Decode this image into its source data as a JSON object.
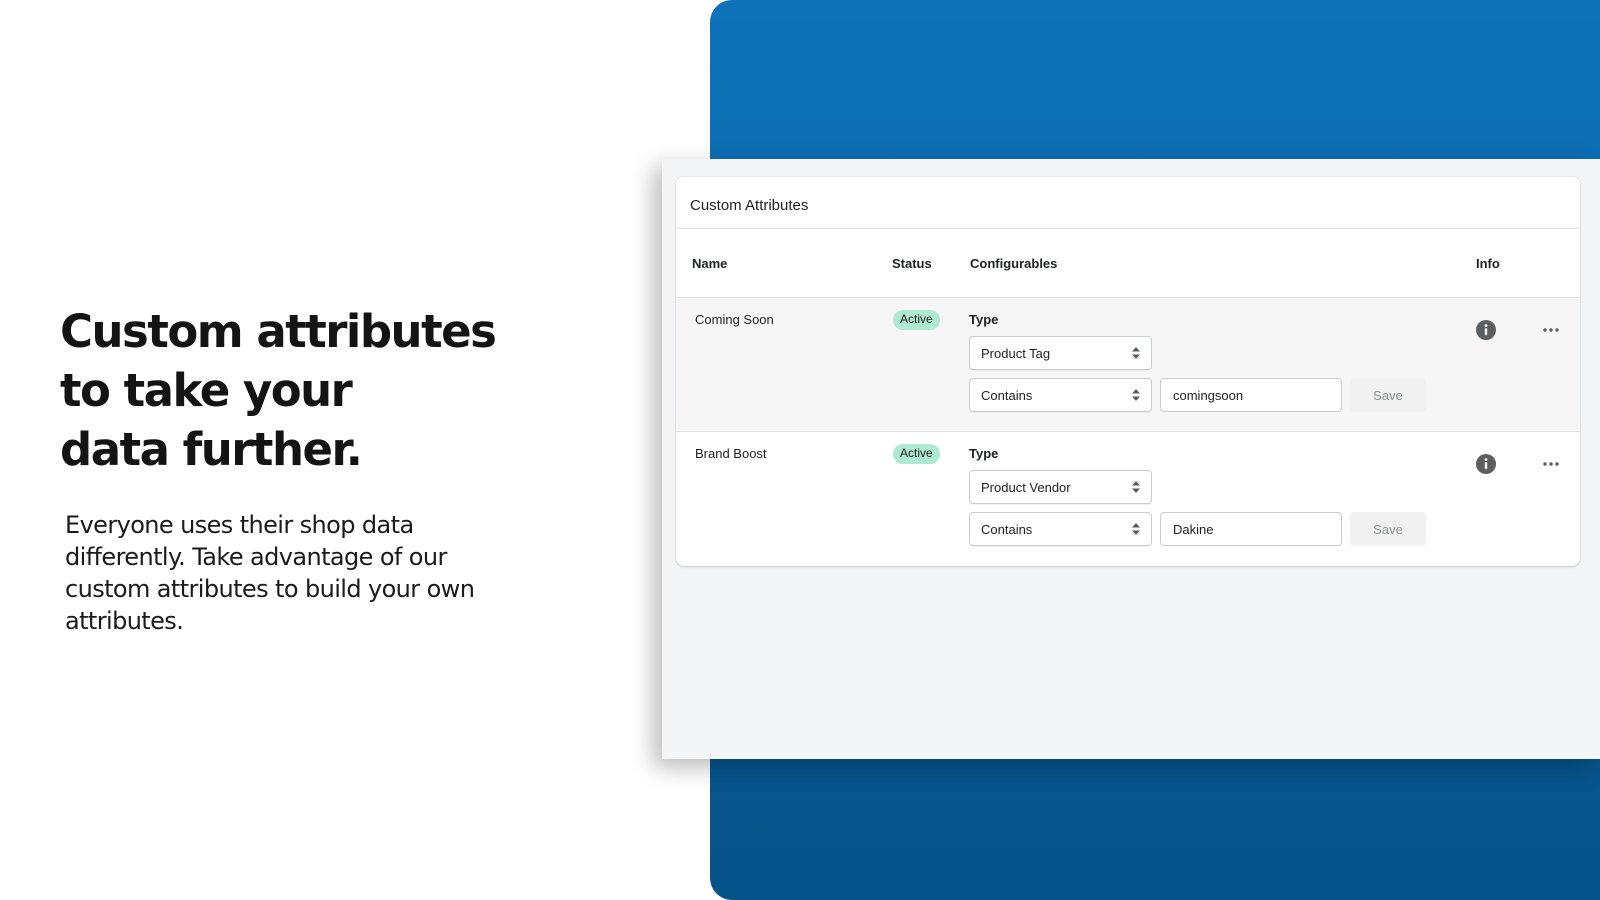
{
  "hero": {
    "title": "Custom attributes\nto take your\ndata further.",
    "body": "Everyone uses their shop data differently. Take advantage of our custom attributes to build your own attributes."
  },
  "colors": {
    "brand_blue": "#0e72b8",
    "badge_active": "#aee9d1"
  },
  "card": {
    "title": "Custom Attributes",
    "columns": {
      "name": "Name",
      "status": "Status",
      "configurables": "Configurables",
      "info": "Info"
    },
    "rows": [
      {
        "name": "Coming Soon",
        "status": "Active",
        "config_label": "Type",
        "type_value": "Product Tag",
        "operator_value": "Contains",
        "input_value": "comingsoon",
        "save_label": "Save",
        "info_icon": "info-icon",
        "more_icon": "more-horizontal-icon"
      },
      {
        "name": "Brand Boost",
        "status": "Active",
        "config_label": "Type",
        "type_value": "Product Vendor",
        "operator_value": "Contains",
        "input_value": "Dakine",
        "save_label": "Save",
        "info_icon": "info-icon",
        "more_icon": "more-horizontal-icon"
      }
    ]
  }
}
